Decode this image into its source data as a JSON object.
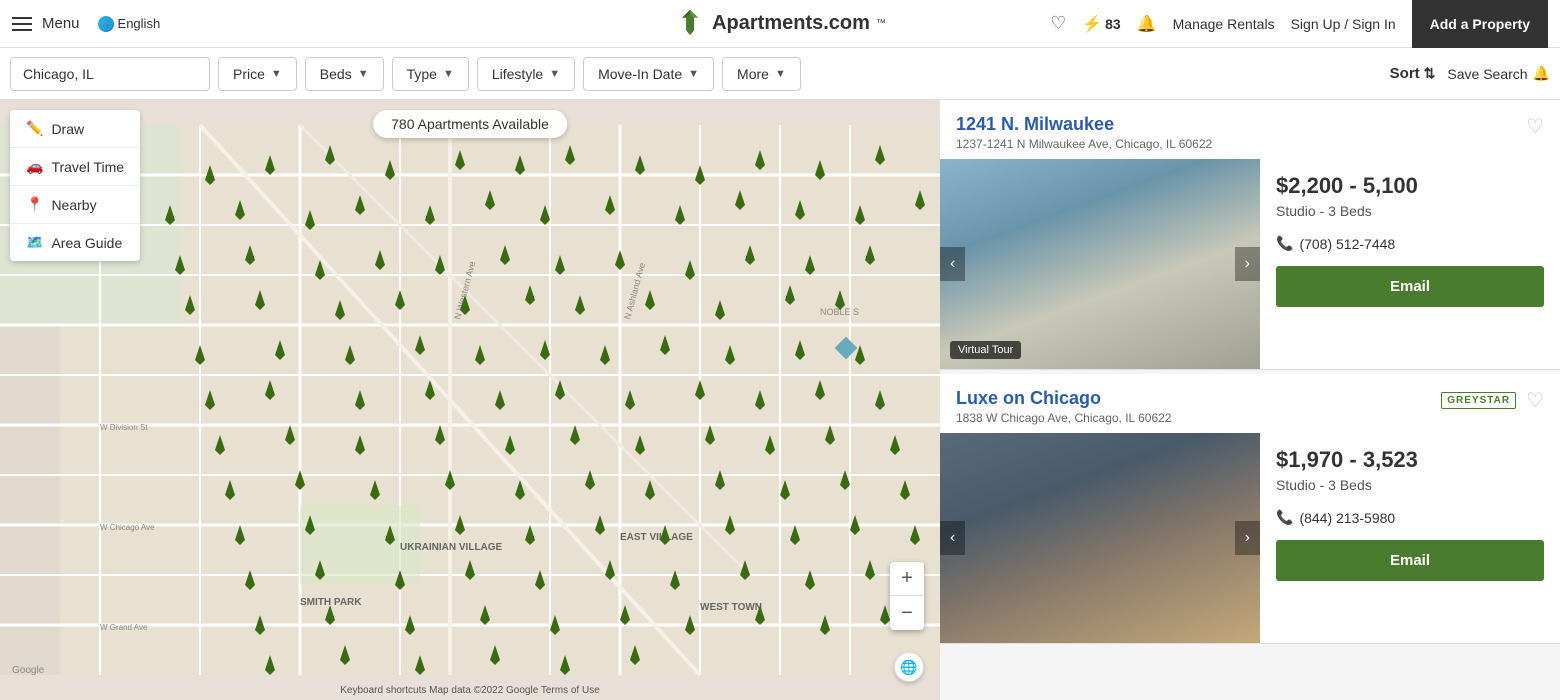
{
  "header": {
    "menu_label": "Menu",
    "language": "English",
    "logo_text": "Apartments.com",
    "logo_tm": "™",
    "bolt_count": "83",
    "manage_rentals": "Manage Rentals",
    "sign_links": "Sign Up / Sign In",
    "add_property_btn": "Add a Property"
  },
  "filters": {
    "search_value": "Chicago, IL",
    "search_placeholder": "Chicago, IL",
    "price_label": "Price",
    "beds_label": "Beds",
    "type_label": "Type",
    "lifestyle_label": "Lifestyle",
    "movein_label": "Move-In Date",
    "more_label": "More",
    "sort_label": "Sort",
    "save_search_label": "Save Search"
  },
  "map": {
    "count_badge": "780 Apartments Available",
    "draw_label": "Draw",
    "travel_label": "Travel Time",
    "nearby_label": "Nearby",
    "area_guide_label": "Area Guide",
    "zoom_in": "+",
    "zoom_out": "−",
    "attribution": "Keyboard shortcuts   Map data ©2022 Google   Terms of Use"
  },
  "listings": [
    {
      "id": "listing-1",
      "title": "1241 N. Milwaukee",
      "address": "1237-1241 N Milwaukee Ave, Chicago, IL 60622",
      "price_range": "$2,200 - 5,100",
      "beds": "Studio - 3 Beds",
      "phone": "(708) 512-7448",
      "virtual_tour": "Virtual Tour",
      "has_logo": false,
      "logo_text": "",
      "email_btn": "Email",
      "img_bg": "linear-gradient(160deg, #8ab4c9 0%, #6a94a9 30%, #c8c8b8 60%, #a0a090 100%)"
    },
    {
      "id": "listing-2",
      "title": "Luxe on Chicago",
      "address": "1838 W Chicago Ave, Chicago, IL 60622",
      "price_range": "$1,970 - 3,523",
      "beds": "Studio - 3 Beds",
      "phone": "(844) 213-5980",
      "virtual_tour": "",
      "has_logo": true,
      "logo_text": "GREYSTAR",
      "email_btn": "Email",
      "img_bg": "linear-gradient(160deg, #5a6a7a 0%, #4a5a6a 30%, #8a7a6a 60%, #c4a87a 100%)"
    }
  ]
}
